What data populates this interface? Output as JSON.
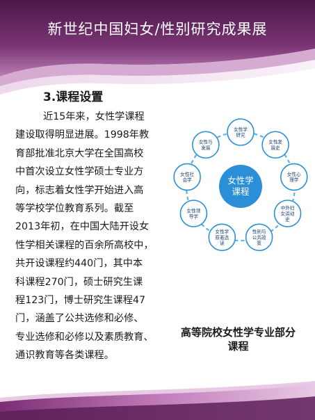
{
  "header": {
    "title": "新世纪中国妇女/性别研究成果展"
  },
  "section": {
    "title": "3.课程设置"
  },
  "body": {
    "lines": [
      "近15年来，女性学课程",
      "建设取得明显进展。1998年教",
      "育部批准北京大学在全国高校",
      "中首次设立女性学硕士专业方",
      "向，标志着女性学开始进入高",
      "等学校学位教育系列。截至",
      "2013年初，在中国大陆开设女",
      "性学相关课程的百余所高校中，",
      "共开设课程约440门，其中本",
      "科课程270门，硕士研究生课",
      "程123门，博士研究生课程47",
      "门，涵盖了公共选修和必修、",
      "专业选修和必修以及素质教育、",
      "通识教育等各类课程。"
    ]
  },
  "diagram": {
    "center": [
      "女性学",
      "课程"
    ],
    "nodes": [
      {
        "lines": [
          "女性学",
          "研究"
        ]
      },
      {
        "lines": [
          "女性发",
          "展史"
        ]
      },
      {
        "lines": [
          "女性心",
          "理学"
        ]
      },
      {
        "lines": [
          "中外妇",
          "女运动",
          "史"
        ]
      },
      {
        "lines": [
          "性别与",
          "公共政",
          "策"
        ]
      },
      {
        "lines": [
          "女性学",
          "原著选",
          "读"
        ]
      },
      {
        "lines": [
          "女性领",
          "导学"
        ]
      },
      {
        "lines": [
          "女性社",
          "会学"
        ]
      },
      {
        "lines": [
          "女性与",
          "发展"
        ]
      }
    ],
    "colors": {
      "circle": "#2a8fd6",
      "ring": "#5fb0e8",
      "node_border": "#2a8fd6",
      "text": "#1a3f73"
    }
  },
  "caption": {
    "lines": [
      "高等院校女性学专业部分",
      "课程"
    ]
  },
  "theme": {
    "header_dark": "#5a1f55",
    "header_light": "#c98fc3",
    "accent": "#8b3b84"
  }
}
